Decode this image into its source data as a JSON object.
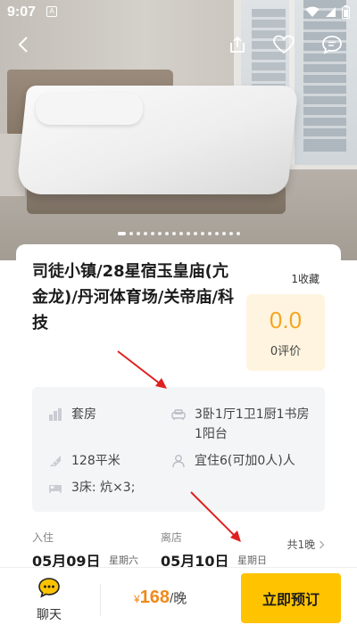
{
  "status_bar": {
    "time": "9:07",
    "notification_icon": "A"
  },
  "nav": {
    "back_icon": "chevron-left-icon",
    "share_icon": "share-icon",
    "favorite_icon": "heart-icon",
    "message_icon": "message-icon"
  },
  "gallery": {
    "page_dots": 17,
    "active_dot_index": 0
  },
  "listing": {
    "title": "司徒小镇/28星宿玉皇庙(亢金龙)/丹河体育场/关帝庙/科技",
    "favorites": "1收藏",
    "score": "0.0",
    "reviews": "0评价"
  },
  "facts": {
    "type": "套房",
    "rooms": "3卧1厅1卫1厨1书房1阳台",
    "area": "128平米",
    "guests": "宜住6(可加0人)人",
    "beds": "3床: 炕×3;"
  },
  "dates": {
    "checkin_label": "入住",
    "checkin_date": "05月09日",
    "checkin_weekday": "星期六",
    "checkout_label": "离店",
    "checkout_date": "05月10日",
    "checkout_weekday": "星期日",
    "nights": "共1晚"
  },
  "bottom": {
    "chat_label": "聊天",
    "currency": "¥",
    "price": "168",
    "price_unit": "/晚",
    "book_label": "立即预订"
  },
  "colors": {
    "accent": "#ffc300",
    "price": "#f08a1a",
    "score": "#f5a623",
    "annotation_arrow": "#e02020"
  }
}
